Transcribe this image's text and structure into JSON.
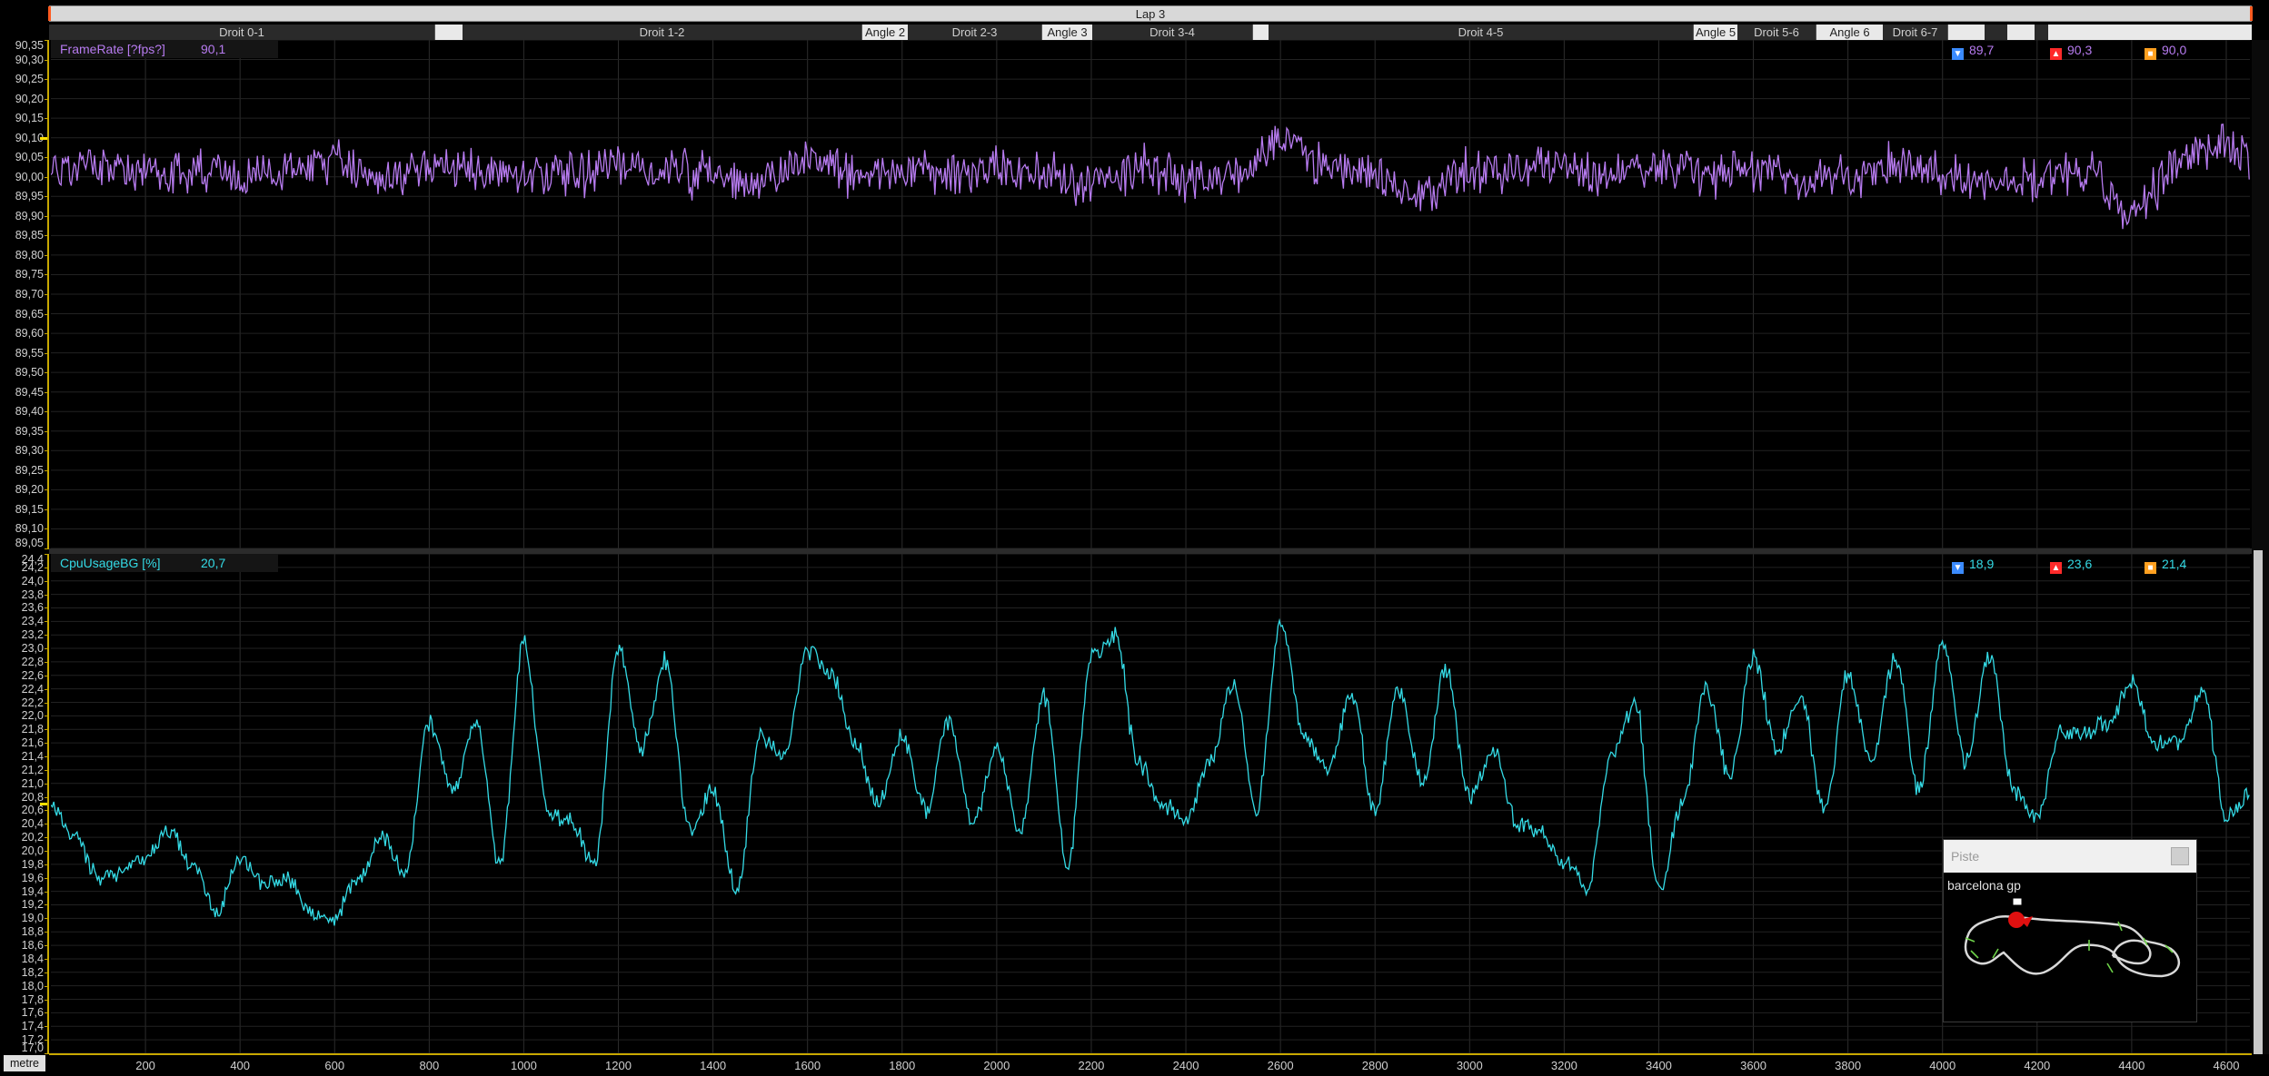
{
  "lap_bar": {
    "label": "Lap 3"
  },
  "segments": [
    {
      "label": "Droit 0-1",
      "kind": "droit",
      "start": 0,
      "end": 425
    },
    {
      "label": "",
      "kind": "blank",
      "start": 425,
      "end": 455
    },
    {
      "label": "Droit 1-2",
      "kind": "droit",
      "start": 455,
      "end": 895
    },
    {
      "label": "Angle 2",
      "kind": "angle",
      "start": 895,
      "end": 945
    },
    {
      "label": "Droit 2-3",
      "kind": "droit",
      "start": 945,
      "end": 1093
    },
    {
      "label": "Angle 3",
      "kind": "angle",
      "start": 1093,
      "end": 1148
    },
    {
      "label": "Droit 3-4",
      "kind": "droit",
      "start": 1148,
      "end": 1325
    },
    {
      "label": "",
      "kind": "blank",
      "start": 1325,
      "end": 1342
    },
    {
      "label": "Droit 4-5",
      "kind": "droit",
      "start": 1342,
      "end": 1810
    },
    {
      "label": "Angle 5",
      "kind": "angle",
      "start": 1810,
      "end": 1858
    },
    {
      "label": "Droit 5-6",
      "kind": "droit",
      "start": 1858,
      "end": 1945
    },
    {
      "label": "Angle 6",
      "kind": "angle",
      "start": 1945,
      "end": 2018
    },
    {
      "label": "Droit 6-7",
      "kind": "droit",
      "start": 2018,
      "end": 2090
    },
    {
      "label": "",
      "kind": "blank",
      "start": 2090,
      "end": 2130
    },
    {
      "label": "",
      "kind": "dark",
      "start": 2130,
      "end": 2155
    },
    {
      "label": "",
      "kind": "blank",
      "start": 2155,
      "end": 2185
    },
    {
      "label": "",
      "kind": "dark",
      "start": 2185,
      "end": 2200
    },
    {
      "label": "",
      "kind": "blank",
      "start": 2200,
      "end": 2424
    }
  ],
  "x_axis": {
    "unit": "metre",
    "range": [
      0,
      4650
    ],
    "ticks": [
      "200",
      "400",
      "600",
      "800",
      "1000",
      "1200",
      "1400",
      "1600",
      "1800",
      "2000",
      "2200",
      "2400",
      "2600",
      "2800",
      "3000",
      "3200",
      "3400",
      "3600",
      "3800",
      "4000",
      "4200",
      "4400",
      "4600"
    ]
  },
  "colors": {
    "framerate": "#b77bf0",
    "cpu": "#34dbe6",
    "min_icon": "#3b8bff",
    "max_icon": "#ff2a2a",
    "avg_icon": "#ffa020",
    "axis": "#c8a800"
  },
  "chart_data": [
    {
      "type": "line",
      "name": "FrameRate [?fps?]",
      "current": "90,1",
      "min": "89,7",
      "max": "90,3",
      "avg": "90,0",
      "ylim": [
        89.05,
        90.35
      ],
      "y_ticks": [
        "90,35",
        "90,30",
        "90,25",
        "90,20",
        "90,15",
        "90,10",
        "90,05",
        "90,00",
        "89,95",
        "89,90",
        "89,85",
        "89,80",
        "89,75",
        "89,70",
        "89,65",
        "89,60",
        "89,55",
        "89,50",
        "89,45",
        "89,40",
        "89,35",
        "89,30",
        "89,25",
        "89,20",
        "89,15",
        "89,10",
        "89,05"
      ],
      "x": [
        0,
        100,
        200,
        300,
        400,
        500,
        600,
        700,
        800,
        900,
        1000,
        1100,
        1200,
        1300,
        1400,
        1500,
        1600,
        1700,
        1800,
        1900,
        2000,
        2100,
        2200,
        2300,
        2400,
        2500,
        2600,
        2700,
        2800,
        2900,
        3000,
        3100,
        3200,
        3300,
        3400,
        3500,
        3600,
        3700,
        3800,
        3900,
        4000,
        4100,
        4200,
        4300,
        4400,
        4500,
        4600,
        4650
      ],
      "values": [
        90.02,
        90.03,
        90.01,
        90.02,
        90.0,
        90.02,
        90.03,
        90.01,
        90.02,
        90.02,
        90.01,
        90.0,
        90.03,
        90.02,
        90.0,
        89.99,
        90.04,
        90.01,
        90.02,
        90.0,
        90.02,
        90.01,
        89.98,
        90.02,
        90.0,
        89.99,
        90.1,
        90.03,
        90.01,
        89.95,
        90.02,
        90.01,
        90.03,
        90.0,
        90.02,
        90.01,
        90.02,
        89.98,
        90.0,
        90.03,
        90.01,
        89.98,
        89.99,
        90.02,
        89.9,
        90.04,
        90.08,
        90.05
      ]
    },
    {
      "type": "line",
      "name": "CpuUsageBG [%]",
      "current": "20,7",
      "min": "18,9",
      "max": "23,6",
      "avg": "21,4",
      "ylim": [
        17.0,
        24.4
      ],
      "y_ticks": [
        "24,4",
        "24,2",
        "24,0",
        "23,8",
        "23,6",
        "23,4",
        "23,2",
        "23,0",
        "22,8",
        "22,6",
        "22,4",
        "22,2",
        "22,0",
        "21,8",
        "21,6",
        "21,4",
        "21,2",
        "21,0",
        "20,8",
        "20,6",
        "20,4",
        "20,2",
        "20,0",
        "19,8",
        "19,6",
        "19,4",
        "19,2",
        "19,0",
        "18,8",
        "18,6",
        "18,4",
        "18,2",
        "18,0",
        "17,8",
        "17,6",
        "17,4",
        "17,2",
        "17,0"
      ],
      "x": [
        0,
        50,
        100,
        150,
        200,
        250,
        300,
        350,
        400,
        450,
        500,
        550,
        600,
        650,
        700,
        750,
        800,
        850,
        900,
        950,
        1000,
        1050,
        1100,
        1150,
        1200,
        1250,
        1300,
        1350,
        1400,
        1450,
        1500,
        1550,
        1600,
        1650,
        1700,
        1750,
        1800,
        1850,
        1900,
        1950,
        2000,
        2050,
        2100,
        2150,
        2200,
        2250,
        2300,
        2350,
        2400,
        2450,
        2500,
        2550,
        2600,
        2650,
        2700,
        2750,
        2800,
        2850,
        2900,
        2950,
        3000,
        3050,
        3100,
        3150,
        3200,
        3250,
        3300,
        3350,
        3400,
        3450,
        3500,
        3550,
        3600,
        3650,
        3700,
        3750,
        3800,
        3850,
        3900,
        3950,
        4000,
        4050,
        4100,
        4150,
        4200,
        4250,
        4300,
        4350,
        4400,
        4450,
        4500,
        4550,
        4600,
        4650
      ],
      "values": [
        20.7,
        20.2,
        19.6,
        19.7,
        19.9,
        20.3,
        19.8,
        19.1,
        19.9,
        19.5,
        19.6,
        19.1,
        19.0,
        19.6,
        20.2,
        19.7,
        21.9,
        20.9,
        21.9,
        19.8,
        23.1,
        20.6,
        20.4,
        19.8,
        23.0,
        21.5,
        22.8,
        20.3,
        20.9,
        19.4,
        21.7,
        21.4,
        23.0,
        22.6,
        21.6,
        20.7,
        21.7,
        20.6,
        21.9,
        20.4,
        21.5,
        20.3,
        22.3,
        19.8,
        22.9,
        23.2,
        21.3,
        20.7,
        20.5,
        21.3,
        22.5,
        20.6,
        23.4,
        21.7,
        21.2,
        22.3,
        20.6,
        22.4,
        21.0,
        22.7,
        20.8,
        21.5,
        20.4,
        20.3,
        19.8,
        19.5,
        21.4,
        22.2,
        19.4,
        20.7,
        22.4,
        21.1,
        22.9,
        21.5,
        22.3,
        20.6,
        22.6,
        21.3,
        22.9,
        20.9,
        23.1,
        21.3,
        22.9,
        20.9,
        20.5,
        21.8,
        21.7,
        21.9,
        22.5,
        21.6,
        21.6,
        22.4,
        20.5,
        20.9
      ]
    }
  ],
  "piste_panel": {
    "title": "Piste",
    "track": "barcelona gp"
  }
}
